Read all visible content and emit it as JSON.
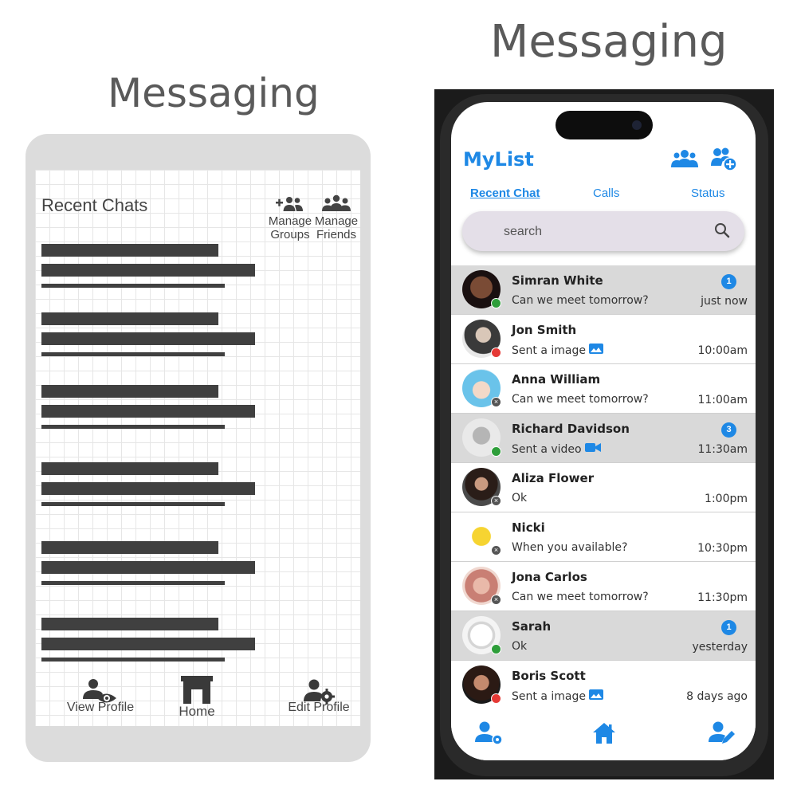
{
  "titles": {
    "left": "Messaging",
    "right": "Messaging"
  },
  "wireframe": {
    "heading": "Recent Chats",
    "actions": [
      {
        "label_line1": "Manage",
        "label_line2": "Groups",
        "icon": "add-group-icon"
      },
      {
        "label_line1": "Manage",
        "label_line2": "Friends",
        "icon": "friends-icon"
      }
    ],
    "nav": {
      "view_profile": "View Profile",
      "home": "Home",
      "edit_profile": "Edit Profile"
    }
  },
  "app": {
    "title": "MyList",
    "header_icons": [
      "group-icon",
      "add-friend-icon"
    ],
    "tabs": [
      {
        "label": "Recent Chat",
        "active": true
      },
      {
        "label": "Calls",
        "active": false
      },
      {
        "label": "Status",
        "active": false
      }
    ],
    "search": {
      "placeholder": "search"
    },
    "accent_color": "#1e88e5",
    "chats": [
      {
        "name": "Simran White",
        "preview": "Can we meet tomorrow?",
        "time": "just now",
        "badge": "1",
        "unread": true,
        "status": "online",
        "attachment": ""
      },
      {
        "name": "Jon Smith",
        "preview": "Sent a image",
        "time": "10:00am",
        "badge": "",
        "unread": false,
        "status": "busy",
        "attachment": "image"
      },
      {
        "name": "Anna William",
        "preview": "Can we meet tomorrow?",
        "time": "11:00am",
        "badge": "",
        "unread": false,
        "status": "offline",
        "attachment": ""
      },
      {
        "name": "Richard Davidson",
        "preview": "Sent a video",
        "time": "11:30am",
        "badge": "3",
        "unread": true,
        "status": "online",
        "attachment": "video"
      },
      {
        "name": "Aliza Flower",
        "preview": "Ok",
        "time": "1:00pm",
        "badge": "",
        "unread": false,
        "status": "offline",
        "attachment": ""
      },
      {
        "name": "Nicki",
        "preview": "When you available?",
        "time": "10:30pm",
        "badge": "",
        "unread": false,
        "status": "offline",
        "attachment": ""
      },
      {
        "name": "Jona Carlos",
        "preview": "Can we meet tomorrow?",
        "time": "11:30pm",
        "badge": "",
        "unread": false,
        "status": "offline",
        "attachment": ""
      },
      {
        "name": "Sarah",
        "preview": "Ok",
        "time": "yesterday",
        "badge": "1",
        "unread": true,
        "status": "online",
        "attachment": ""
      },
      {
        "name": "Boris Scott",
        "preview": "Sent a image",
        "time": "8 days ago",
        "badge": "",
        "unread": false,
        "status": "busy",
        "attachment": "image"
      }
    ],
    "bottom_nav": [
      "profile-icon",
      "home-icon",
      "edit-profile-icon"
    ]
  }
}
